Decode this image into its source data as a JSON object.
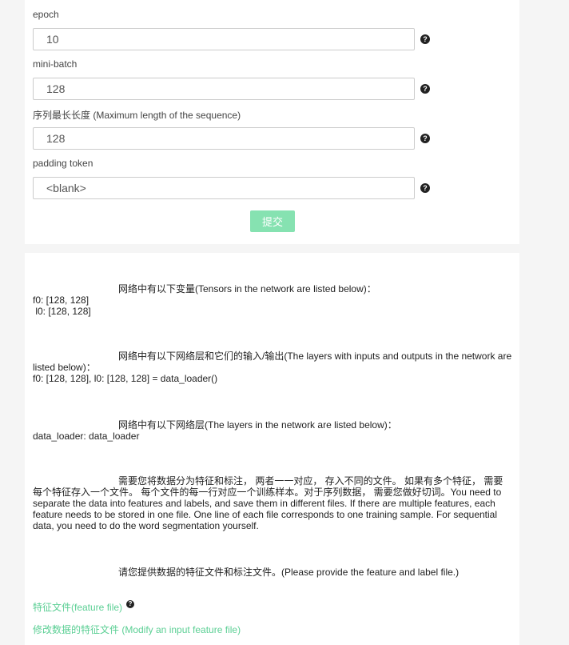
{
  "form": {
    "fields": [
      {
        "label": "epoch",
        "value": "10"
      },
      {
        "label": "mini-batch",
        "value": "128"
      },
      {
        "label": "序列最长长度 (Maximum length of the sequence)",
        "value": "128"
      },
      {
        "label": "padding token",
        "value": "<blank>"
      }
    ],
    "help_glyph": "?",
    "submit_label": "提交"
  },
  "info": {
    "tensors": {
      "heading": "网络中有以下变量(Tensors in the network are listed below)：",
      "lines": [
        "f0: [128, 128]",
        " l0: [128, 128]"
      ]
    },
    "layers_io": {
      "heading_first": "网络中有以下网络层和它们的输入/输出(The layers with inputs and outputs in the network are",
      "heading_second": "listed below)：",
      "lines": [
        "f0: [128, 128], l0: [128, 128] = data_loader()"
      ]
    },
    "layers": {
      "heading": "网络中有以下网络层(The layers in the network are listed below)：",
      "lines": [
        "data_loader: data_loader"
      ]
    },
    "instructions": {
      "first": "需要您将数据分为特征和标注， 两者一一对应， 存入不同的文件。 如果有多个特征， 需要",
      "rest": [
        "每个特征存入一个文件。 每个文件的每一行对应一个训练样本。对于序列数据， 需要您做好切词。You need to",
        "separate the data into features and labels, and save them in different files. If there are multiple features, each",
        "feature needs to be stored in one file. One line of each file corresponds to one training sample. For sequential",
        "data, you need to do the word segmentation yourself."
      ]
    },
    "provide_files": "请您提供数据的特征文件和标注文件。(Please provide the feature and label file.)",
    "feature_file_link": "特征文件(feature file)",
    "modify_feature_link": "修改数据的特征文件 (Modify an input feature file)"
  },
  "colors": {
    "accent": "#5bcf94",
    "submit_button": "#86e2b1",
    "help_icon": "#222222"
  }
}
